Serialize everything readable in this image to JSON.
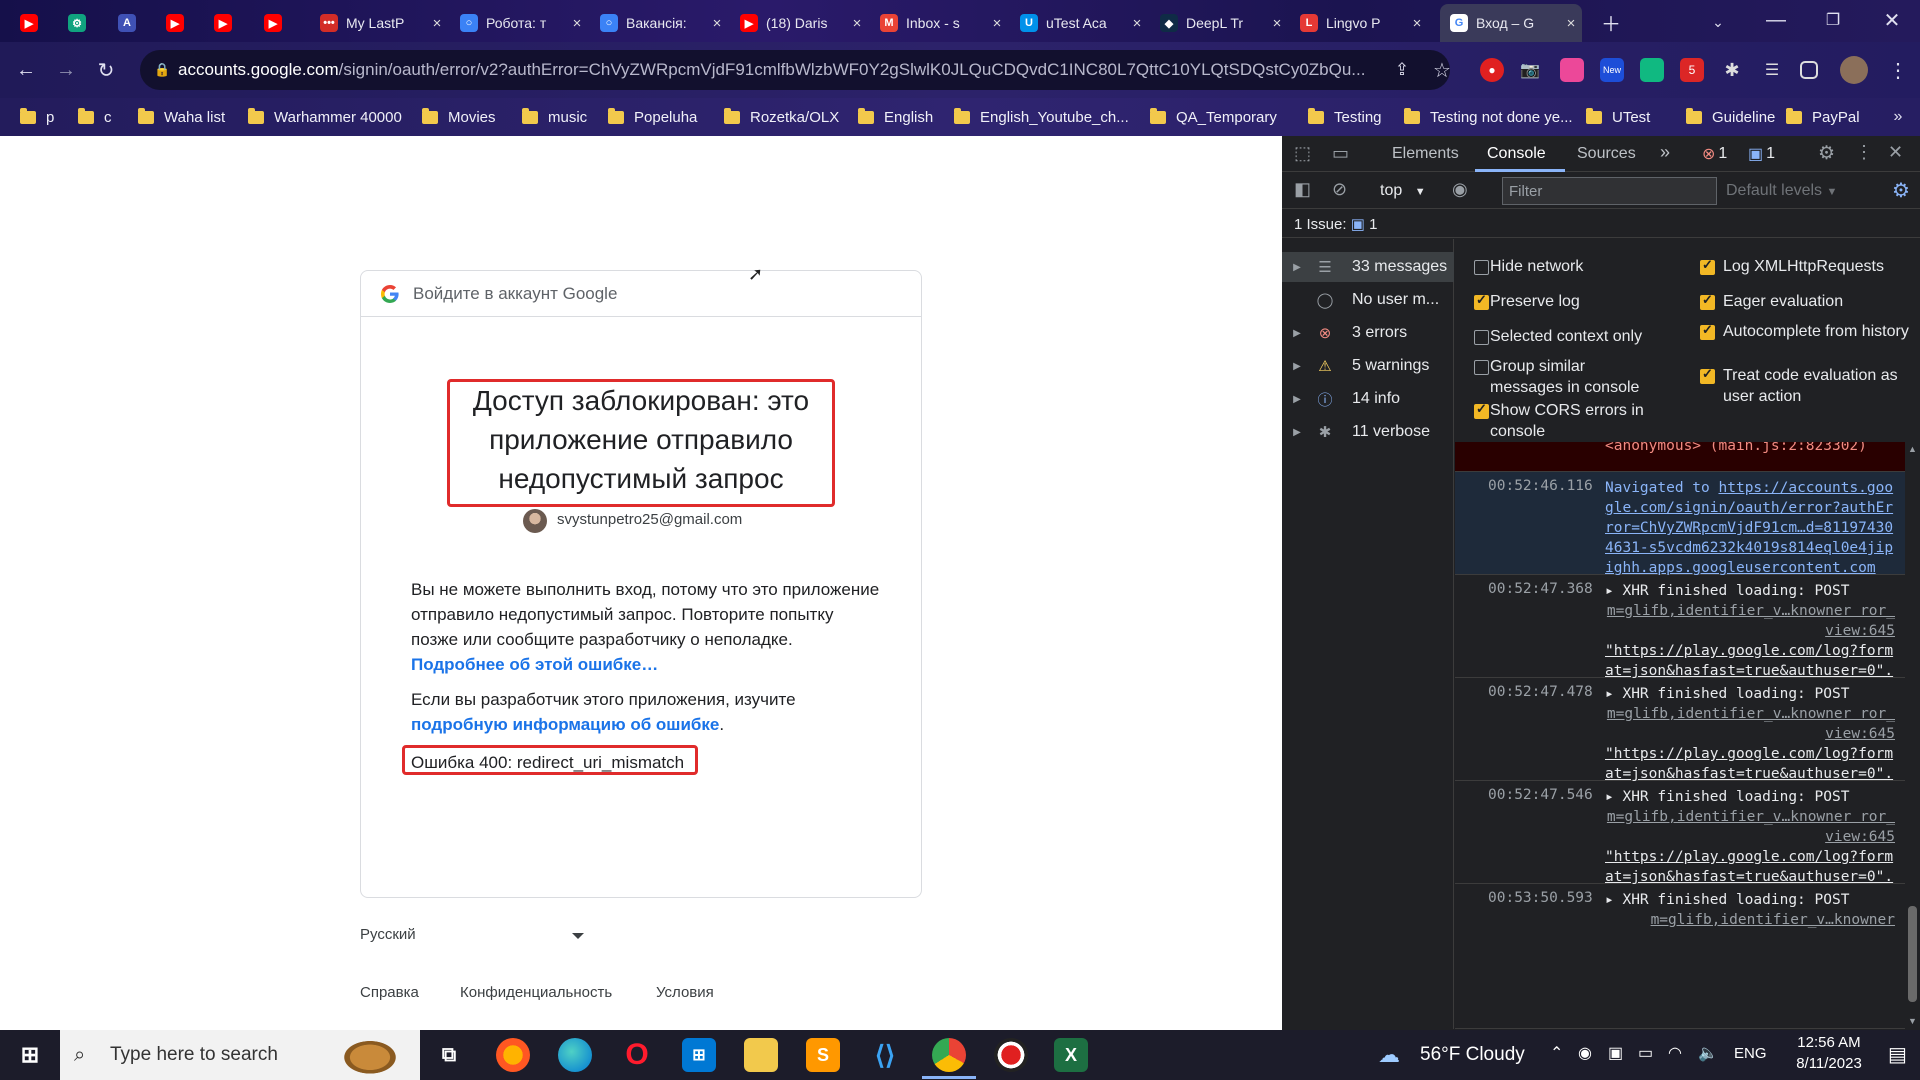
{
  "tabs": [
    {
      "title": "",
      "color": "#ff0000",
      "glyph": "▶"
    },
    {
      "title": "",
      "color": "#10a37f",
      "glyph": "⚙"
    },
    {
      "title": "",
      "color": "#3f51b5",
      "glyph": "A"
    },
    {
      "title": "",
      "color": "#ff0000",
      "glyph": "▶"
    },
    {
      "title": "",
      "color": "#ff0000",
      "glyph": "▶"
    },
    {
      "title": "",
      "color": "#ff0000",
      "glyph": "▶"
    },
    {
      "title": "My LastP",
      "color": "#d32d27",
      "glyph": "•••"
    },
    {
      "title": "Робота: т",
      "color": "#3b82f6",
      "glyph": "○"
    },
    {
      "title": "Вакансія:",
      "color": "#3b82f6",
      "glyph": "○"
    },
    {
      "title": "(18) Daris",
      "color": "#ff0000",
      "glyph": "▶"
    },
    {
      "title": "Inbox - s",
      "color": "#ea4335",
      "glyph": "M"
    },
    {
      "title": "uTest Aca",
      "color": "#0091ea",
      "glyph": "U"
    },
    {
      "title": "DeepL Tr",
      "color": "#0f2b46",
      "glyph": "◆"
    },
    {
      "title": "Lingvo P",
      "color": "#e53935",
      "glyph": "L"
    },
    {
      "title": "Вход – G",
      "color": "#ffffff",
      "glyph": "G"
    }
  ],
  "address": {
    "host": "accounts.google.com",
    "path": "/signin/oauth/error/v2?authError=ChVyZWRpcmVjdF91cmlfbWlzbWF0Y2gSlwlK0JLQuCDQvdC1INC80L7QttC10YLQtSDQstCy0ZbQu..."
  },
  "bookmarks": [
    "p",
    "c",
    "Waha list",
    "Warhammer 40000",
    "Movies",
    "music",
    "Popeluha",
    "Rozetka/OLX",
    "English",
    "English_Youtube_ch...",
    "QA_Temporary",
    "Testing",
    "Testing not done ye...",
    "UTest",
    "Guideline",
    "PayPal"
  ],
  "signin": {
    "header": "Войдите в аккаунт Google",
    "title": "Доступ заблокирован: это приложение отправило недопустимый запрос",
    "email": "svystunpetro25@gmail.com",
    "body1": "Вы не можете выполнить вход, потому что это приложение отправило недопустимый запрос. Повторите попытку позже или сообщите разработчику о неполадке. ",
    "body1_link": "Подробнее об этой ошибке…",
    "body2": "Если вы разработчик этого приложения, изучите ",
    "body2_link": "подробную информацию об ошибке",
    "body2_end": ".",
    "error": "Ошибка 400: redirect_uri_mismatch",
    "language": "Русский",
    "footer": [
      "Справка",
      "Конфиденциальность",
      "Условия"
    ]
  },
  "devtools": {
    "tabs": [
      "Elements",
      "Console",
      "Sources"
    ],
    "error_count": "1",
    "issue_count": "1",
    "context": "top",
    "filter_placeholder": "Filter",
    "levels": "Default levels",
    "issues_label": "1 Issue:",
    "issues_count": "1",
    "sidebar": [
      {
        "label": "33 messages",
        "icon": "☰",
        "color": "#9aa0a6"
      },
      {
        "label": "No user m...",
        "icon": "◯",
        "color": "#9aa0a6"
      },
      {
        "label": "3 errors",
        "icon": "⊗",
        "color": "#f28b82"
      },
      {
        "label": "5 warnings",
        "icon": "⚠",
        "color": "#fdd663"
      },
      {
        "label": "14 info",
        "icon": "ⓘ",
        "color": "#8ab4f8"
      },
      {
        "label": "11 verbose",
        "icon": "✱",
        "color": "#9aa0a6"
      }
    ],
    "settings_left": [
      {
        "label": "Hide network",
        "checked": false
      },
      {
        "label": "Preserve log",
        "checked": true
      },
      {
        "label": "Selected context only",
        "checked": false
      },
      {
        "label": "Group similar messages in console",
        "checked": false
      },
      {
        "label": "Show CORS errors in console",
        "checked": true
      }
    ],
    "settings_right": [
      {
        "label": "Log XMLHttpRequests",
        "checked": true
      },
      {
        "label": "Eager evaluation",
        "checked": true
      },
      {
        "label": "Autocomplete from history",
        "checked": true
      },
      {
        "label": "Treat code evaluation as user action",
        "checked": true
      }
    ],
    "log": [
      {
        "time": "",
        "text": "<anonymous> (main.js:2:823302)"
      },
      {
        "time": "00:52:46.116",
        "prefix": "Navigated to ",
        "text": "https://accounts.google.com/signin/oauth/error?authError=ChVyZWRpcmVjdF91cm…d=811974304631-s5vcdm6232k4019s814eql0e4jipighh.apps.googleusercontent.com"
      },
      {
        "time": "00:52:47.368",
        "prefix": "▸ XHR finished loading: POST",
        "src": "m=glifb,identifier_v…knowner ror_view:645",
        "text": "\"https://play.google.com/log?format=json&hasfast=true&authuser=0\"."
      },
      {
        "time": "00:52:47.478",
        "prefix": "▸ XHR finished loading: POST",
        "src": "m=glifb,identifier_v…knowner ror_view:645",
        "text": "\"https://play.google.com/log?format=json&hasfast=true&authuser=0\"."
      },
      {
        "time": "00:52:47.546",
        "prefix": "▸ XHR finished loading: POST",
        "src": "m=glifb,identifier_v…knowner ror_view:645",
        "text": "\"https://play.google.com/log?format=json&hasfast=true&authuser=0\"."
      },
      {
        "time": "00:53:50.593",
        "prefix": "▸ XHR finished loading: POST",
        "src": "m=glifb,identifier_v…knowner",
        "text": ""
      }
    ]
  },
  "taskbar": {
    "search_placeholder": "Type here to search",
    "weather": "56°F  Cloudy",
    "lang": "ENG",
    "time": "12:56 AM",
    "date": "8/11/2023"
  }
}
